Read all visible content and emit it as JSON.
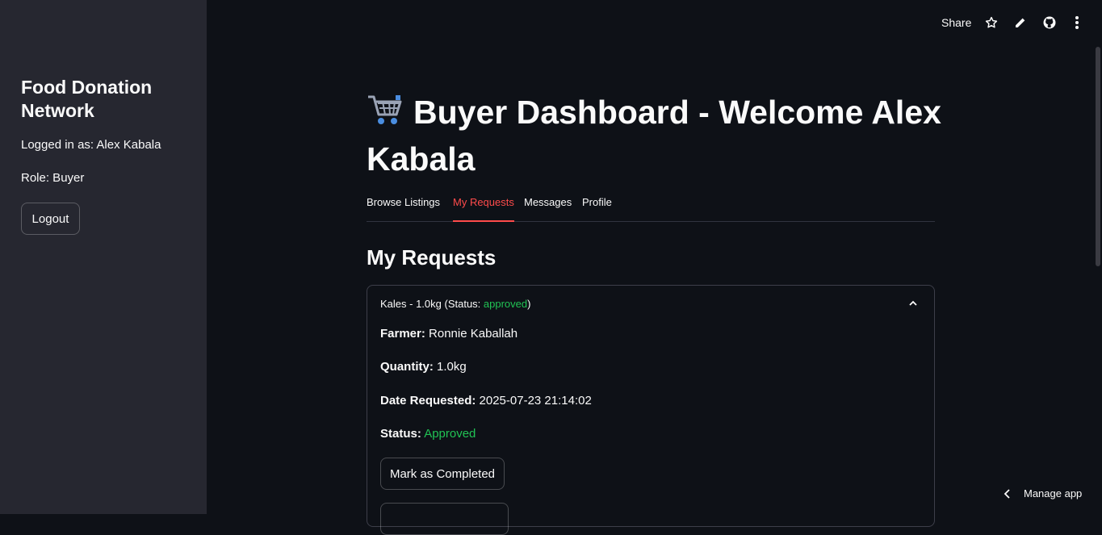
{
  "sidebar": {
    "title": "Food Donation Network",
    "logged_in": "Logged in as: Alex Kabala",
    "role": "Role: Buyer",
    "logout_label": "Logout"
  },
  "topbar": {
    "share_label": "Share",
    "icons": [
      "star-icon",
      "pencil-icon",
      "github-icon",
      "more-vert-icon"
    ]
  },
  "main": {
    "title": "Buyer Dashboard - Welcome Alex Kabala",
    "title_icon": "shopping-cart-icon",
    "tabs": [
      {
        "label": "Browse Listings",
        "active": false
      },
      {
        "label": "My Requests",
        "active": true
      },
      {
        "label": "Messages",
        "active": false
      },
      {
        "label": "Profile",
        "active": false
      }
    ],
    "section_title": "My Requests",
    "request": {
      "header_prefix": "Kales - 1.0kg (Status: ",
      "header_status": "approved",
      "header_suffix": ")",
      "farmer_label": "Farmer:",
      "farmer_value": "Ronnie Kaballah",
      "quantity_label": "Quantity:",
      "quantity_value": "1.0kg",
      "date_label": "Date Requested:",
      "date_value": "2025-07-23 21:14:02",
      "status_label": "Status:",
      "status_value": "Approved",
      "complete_button": "Mark as Completed"
    }
  },
  "footer": {
    "manage_label": "Manage app"
  },
  "colors": {
    "accent": "#ff4b4b",
    "success": "#21c354",
    "sidebar_bg": "#262730",
    "main_bg": "#0e1117"
  }
}
